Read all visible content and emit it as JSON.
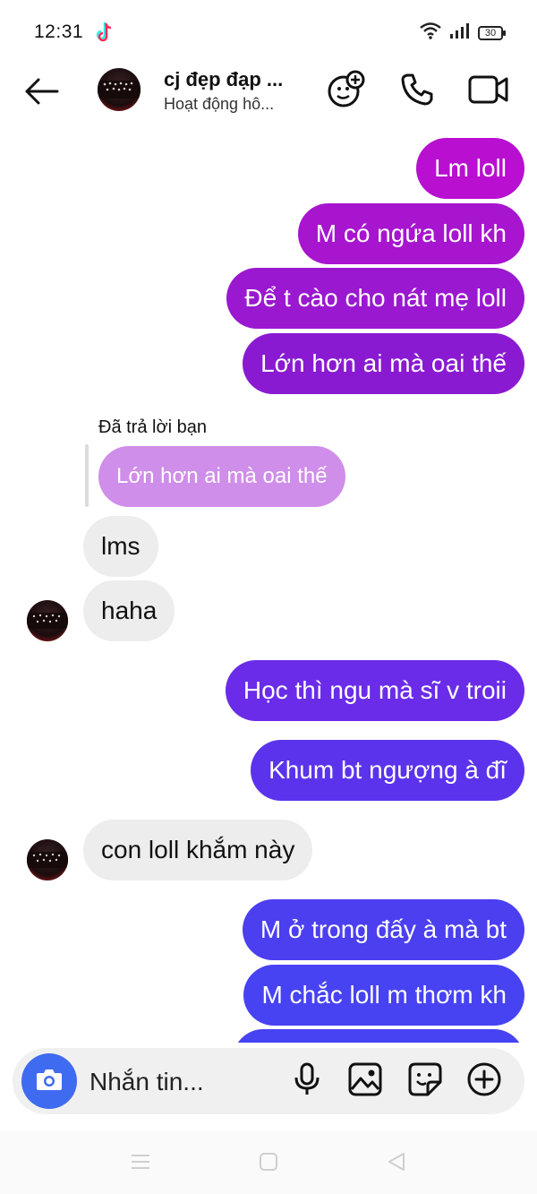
{
  "status_bar": {
    "time": "12:31",
    "battery": "30",
    "icons": [
      "tiktok-icon",
      "wifi-icon",
      "signal-icon",
      "battery-icon"
    ]
  },
  "header": {
    "contact_name": "cj đẹp đạp ...",
    "contact_status": "Hoạt động hô...",
    "icons": [
      "back-arrow-icon",
      "add-person-icon",
      "phone-icon",
      "video-camera-icon"
    ]
  },
  "messages": [
    {
      "id": "m1",
      "text": "Lm loll",
      "from": "me"
    },
    {
      "id": "m2",
      "text": "M có ngứa loll kh",
      "from": "me"
    },
    {
      "id": "m3",
      "text": "Để t cào cho nát mẹ loll",
      "from": "me"
    },
    {
      "id": "m4",
      "text": "Lớn hơn ai mà oai thế",
      "from": "me"
    },
    {
      "id": "reply_label",
      "text": "Đã trả lời bạn"
    },
    {
      "id": "reply_quote",
      "text": "Lớn hơn ai mà oai thế"
    },
    {
      "id": "m5",
      "text": "lms",
      "from": "them"
    },
    {
      "id": "m6",
      "text": "haha",
      "from": "them"
    },
    {
      "id": "m7",
      "text": "Học thì ngu mà sĩ v troii",
      "from": "me"
    },
    {
      "id": "m8",
      "text": "Khum bt ngượng à đĩ",
      "from": "me"
    },
    {
      "id": "m9",
      "text": "con loll khắm này",
      "from": "them"
    },
    {
      "id": "m10",
      "text": "M ở trong đấy à mà bt",
      "from": "me"
    },
    {
      "id": "m11",
      "text": "M chắc loll m thơm kh",
      "from": "me"
    }
  ],
  "bubble_colors": {
    "m1": "#b80fd0",
    "m2": "#a715cf",
    "m3": "#9a18d0",
    "m4": "#8a1ad2",
    "m7": "#6a2ce8",
    "m8": "#5b33ec",
    "m10": "#4b3ff0",
    "m11": "#4743f2",
    "reply_quote": "#cf8ee9",
    "incoming": "#ededed"
  },
  "composer": {
    "placeholder": "Nhắn tin...",
    "icons": [
      "camera-icon",
      "microphone-icon",
      "image-icon",
      "sticker-icon",
      "plus-icon"
    ]
  },
  "nav_bar": {
    "icons": [
      "menu-icon",
      "home-icon",
      "back-icon"
    ]
  }
}
